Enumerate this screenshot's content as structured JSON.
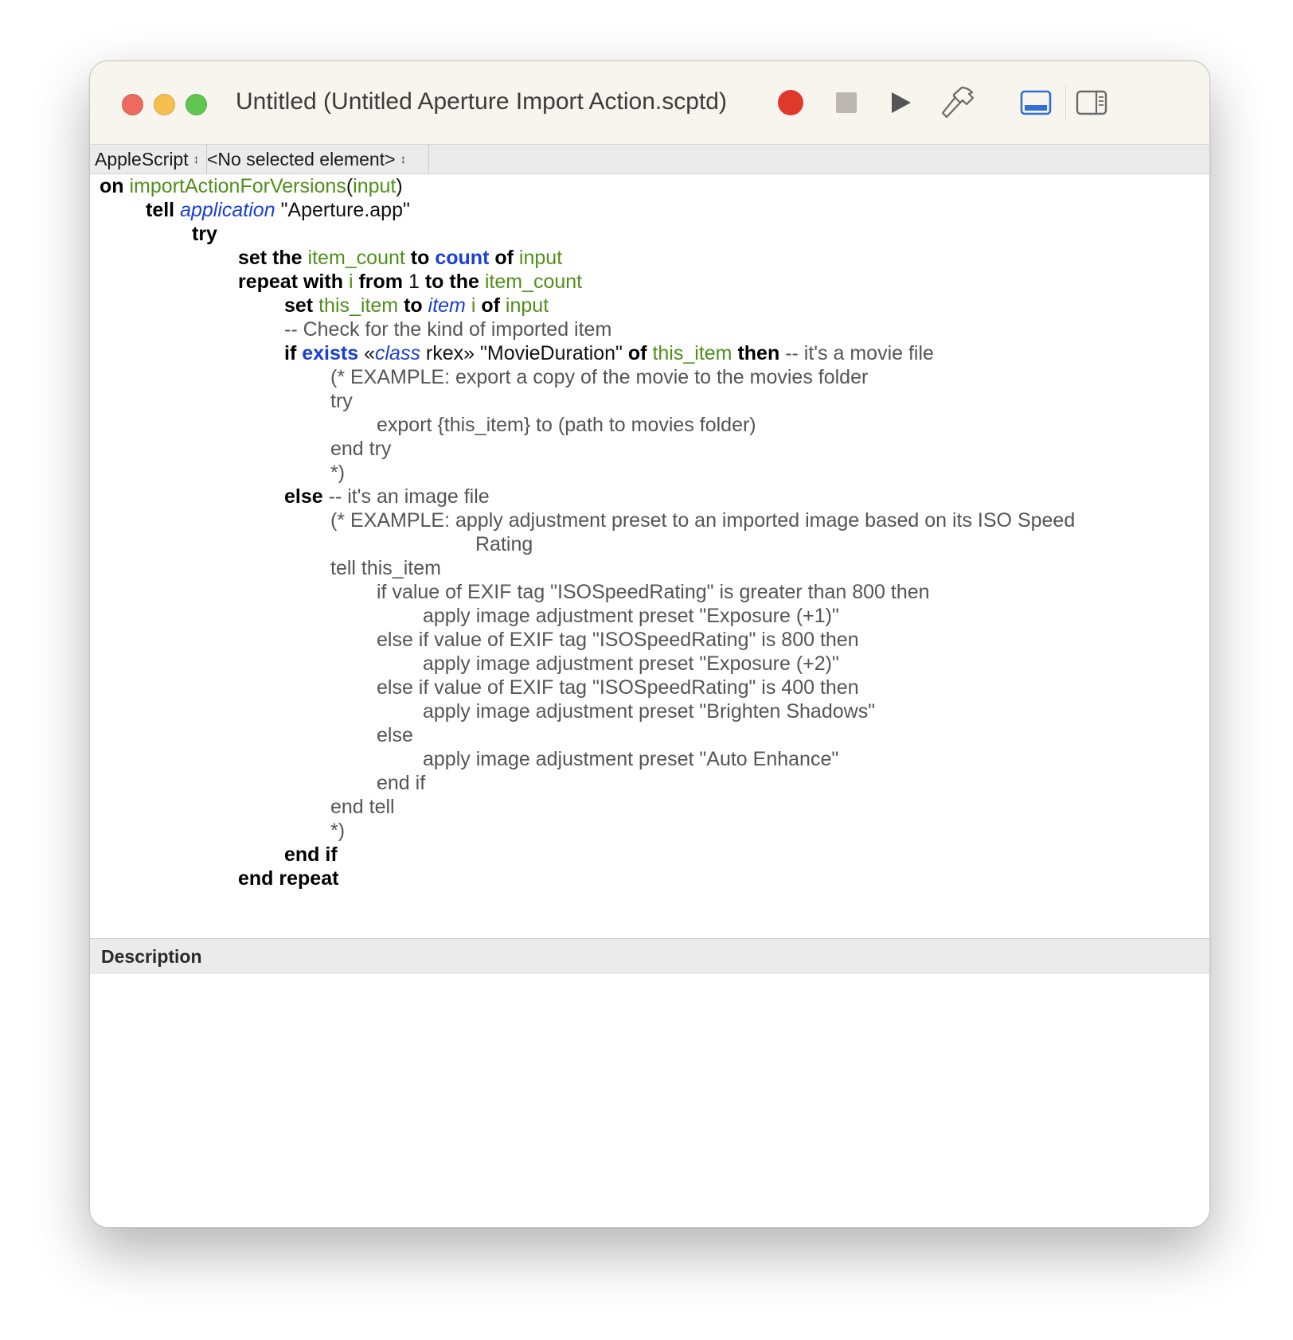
{
  "window": {
    "title": "Untitled (Untitled Aperture Import Action.scptd)"
  },
  "toolbar": {
    "record_icon": "record-icon",
    "stop_icon": "stop-icon",
    "run_icon": "play-icon",
    "compile_icon": "hammer-icon",
    "bottom_panel_icon": "show-bottom-panel-icon",
    "sidebar_icon": "show-sidebar-icon",
    "colors": {
      "record": "#e0392b",
      "stop": "#bcb7b0",
      "run": "#555555",
      "active_panel": "#2f6fd6"
    }
  },
  "navigation": {
    "language": "AppleScript",
    "element": "<No selected element>"
  },
  "code_colors": {
    "keyword": "#000000",
    "variable": "#4f8f1a",
    "application": "#1a3fd6",
    "comment": "#555555"
  },
  "code": {
    "l1": [
      "on",
      "importActionForVersions",
      "(",
      "input",
      ")"
    ],
    "l2": [
      "tell",
      "application",
      "\"Aperture.app\""
    ],
    "l3": [
      "try"
    ],
    "l4": [
      "set the",
      "item_count",
      "to",
      "count",
      "of",
      "input"
    ],
    "l5": [
      "repeat with",
      "i",
      "from",
      "1",
      "to the",
      "item_count"
    ],
    "l6": [
      "set",
      "this_item",
      "to",
      "item",
      "i",
      "of",
      "input"
    ],
    "l7": [
      "-- Check for the kind of imported item"
    ],
    "l8": [
      "if",
      "exists",
      "«",
      "class",
      "rkex»",
      "\"MovieDuration\"",
      "of",
      "this_item",
      "then",
      "-- it's a movie file"
    ],
    "l9": [
      "(* EXAMPLE: export a copy of the movie to the movies folder"
    ],
    "l10": [
      "try"
    ],
    "l11": [
      "export {this_item} to (path to movies folder)"
    ],
    "l12": [
      "end try"
    ],
    "l13": [
      "*)"
    ],
    "l14": [
      "else",
      "-- it's an image file"
    ],
    "l15": [
      "(* EXAMPLE: apply adjustment preset to an imported image based on its ISO Speed"
    ],
    "l16": [
      "Rating"
    ],
    "l17": [
      "tell this_item"
    ],
    "l18": [
      "if value of EXIF tag \"ISOSpeedRating\" is greater than 800 then"
    ],
    "l19": [
      "apply image adjustment preset \"Exposure (+1)\""
    ],
    "l20": [
      "else if value of EXIF tag \"ISOSpeedRating\" is 800 then"
    ],
    "l21": [
      "apply image adjustment preset \"Exposure (+2)\""
    ],
    "l22": [
      "else if value of EXIF tag \"ISOSpeedRating\" is 400 then"
    ],
    "l23": [
      "apply image adjustment preset \"Brighten Shadows\""
    ],
    "l24": [
      "else"
    ],
    "l25": [
      "apply image adjustment preset \"Auto Enhance\""
    ],
    "l26": [
      "end if"
    ],
    "l27": [
      "end tell"
    ],
    "l28": [
      "*)"
    ],
    "l29": [
      "end if"
    ],
    "l30": [
      "end repeat"
    ]
  },
  "description": {
    "title": "Description",
    "text": ""
  },
  "bottom_bar": {
    "info_icon": "info-icon",
    "replies_icon": "return-arrow-icon",
    "log_icon": "list-icon"
  }
}
